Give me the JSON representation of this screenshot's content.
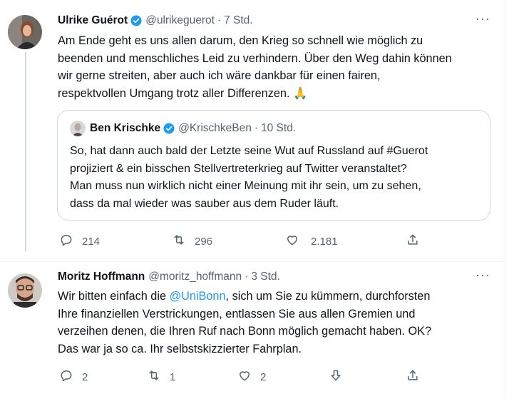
{
  "tweets": [
    {
      "author_name": "Ulrike Guérot",
      "handle": "@ulrikeguerot",
      "separator": "·",
      "time": "7 Std.",
      "text_lines": [
        "Am Ende geht es uns allen darum, den Krieg so schnell wie möglich zu",
        "beenden und menschliches Leid zu verhindern. Über den Weg dahin können",
        "wir gerne streiten, aber auch ich wäre dankbar für einen fairen,",
        "respektvollen Umgang trotz aller Differenzen. 🙏"
      ],
      "quote": {
        "author_name": "Ben Krischke",
        "handle": "@KrischkeBen",
        "separator": "·",
        "time": "10 Std.",
        "text_lines": [
          "So, hat dann auch bald der Letzte seine Wut auf Russland auf #Guerot",
          "projiziert & ein bisschen Stellvertreterkrieg auf Twitter veranstaltet?",
          "Man muss nun wirklich nicht einer Meinung mit ihr sein, um zu sehen,",
          "dass da mal wieder was sauber aus dem Ruder läuft."
        ]
      },
      "replies": "214",
      "retweets": "296",
      "likes": "2.181"
    },
    {
      "author_name": "Moritz Hoffmann",
      "handle": "@moritz_hoffmann",
      "separator": "·",
      "time": "3 Std.",
      "line1_before": "Wir bitten einfach die ",
      "line1_mention": "@UniBonn",
      "line1_after": ", sich um Sie zu kümmern, durchforsten",
      "text_lines_rest": [
        "Ihre finanziellen Verstrickungen, entlassen Sie aus allen Gremien und",
        "verzeihen denen, die Ihren Ruf nach Bonn möglich gemacht haben. OK?",
        "Das war ja so ca. Ihr selbstskizzierter Fahrplan."
      ],
      "replies": "2",
      "retweets": "1",
      "likes": "2"
    }
  ],
  "icons": {
    "more": "more-icon",
    "reply": "reply-icon",
    "retweet": "retweet-icon",
    "like": "heart-icon",
    "share": "share-icon",
    "downvote": "downvote-icon",
    "verified": "verified-badge-icon"
  },
  "colors": {
    "accent": "#1d9bf0",
    "text": "#0f1419",
    "secondary": "#536471",
    "border": "#cfd9de"
  }
}
